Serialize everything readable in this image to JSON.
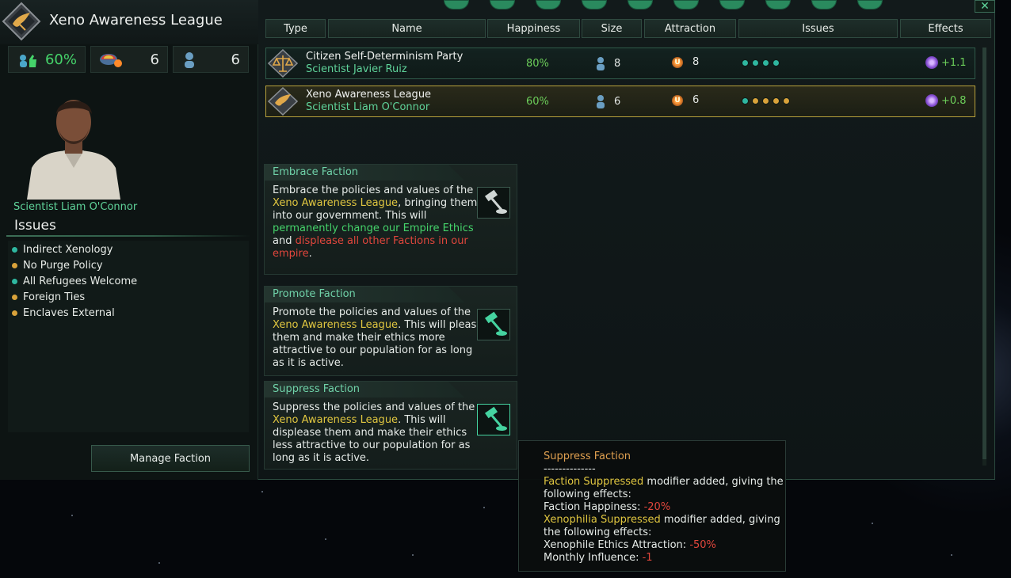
{
  "faction_header": {
    "title": "Xeno Awareness League",
    "happiness": "60%",
    "support": "6",
    "size": "6",
    "leader": "Scientist Liam O'Connor",
    "issues_title": "Issues"
  },
  "issues": [
    {
      "label": "Indirect Xenology",
      "color": "teal"
    },
    {
      "label": "No Purge Policy",
      "color": "yellow"
    },
    {
      "label": "All Refugees Welcome",
      "color": "teal"
    },
    {
      "label": "Foreign Ties",
      "color": "yellow"
    },
    {
      "label": "Enclaves External",
      "color": "yellow"
    }
  ],
  "manage_button": "Manage Faction",
  "table": {
    "headers": [
      "Type",
      "Name",
      "Happiness",
      "Size",
      "Attraction",
      "Issues",
      "Effects"
    ],
    "rows": [
      {
        "name": "Citizen Self-Determinism Party",
        "leader": "Scientist Javier Ruiz",
        "happiness": "80%",
        "size": "8",
        "attraction": "8",
        "issues": [
          "teal",
          "teal",
          "teal",
          "teal"
        ],
        "effects": "+1.1",
        "selected": false
      },
      {
        "name": "Xeno Awareness League",
        "leader": "Scientist Liam O'Connor",
        "happiness": "60%",
        "size": "6",
        "attraction": "6",
        "issues": [
          "teal",
          "yellow",
          "yellow",
          "yellow",
          "yellow"
        ],
        "effects": "+0.8",
        "selected": true
      }
    ]
  },
  "actions": {
    "embrace": {
      "title": "Embrace Faction",
      "t1": "Embrace the policies and values of the ",
      "t2": "Xeno Awareness League",
      "t3": ", bringing them into our government. This will ",
      "t4": "permanently change our Empire Ethics",
      "t5": " and ",
      "t6": "displease all other Factions in our empire",
      "t7": "."
    },
    "promote": {
      "title": "Promote Faction",
      "t1": "Promote the policies and values of the ",
      "t2": "Xeno Awareness League",
      "t3": ". This will please them and make their ethics more attractive to our population for as long as it is active."
    },
    "suppress": {
      "title": "Suppress Faction",
      "t1": "Suppress the policies and values of the ",
      "t2": "Xeno Awareness League",
      "t3": ". This will displease them and make their ethics less attractive to our population for as long as it is active."
    }
  },
  "tooltip": {
    "title": "Suppress Faction",
    "sep": "--------------",
    "m1": "Faction Suppressed",
    "m1_rest": " modifier added, giving the following effects:",
    "e1_label": "Faction Happiness: ",
    "e1_val": "-20%",
    "m2": "Xenophilia Suppressed",
    "m2_rest": " modifier added, giving the following effects:",
    "e2_label": "Xenophile Ethics Attraction: ",
    "e2_val": "-50%",
    "e3_label": "Monthly Influence: ",
    "e3_val": "-1"
  },
  "colors": {
    "accent": "#5fd39a",
    "highlight": "#e0c640",
    "negative": "#e0463c",
    "positive": "#45d36a"
  }
}
